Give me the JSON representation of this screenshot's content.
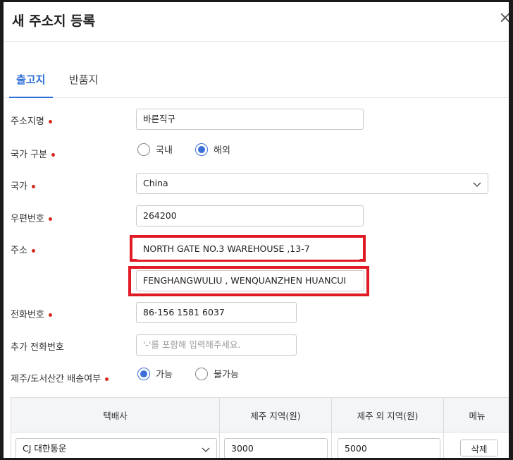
{
  "dialog": {
    "title": "새 주소지 등록",
    "close_glyph": "×"
  },
  "tabs": [
    {
      "label": "출고지",
      "active": true
    },
    {
      "label": "반품지",
      "active": false
    }
  ],
  "form": {
    "alias": {
      "label": "주소지명",
      "value": "바른직구"
    },
    "country_type": {
      "label": "국가 구분",
      "options": [
        {
          "label": "국내",
          "checked": false
        },
        {
          "label": "해외",
          "checked": true
        }
      ]
    },
    "country": {
      "label": "국가",
      "value": "China"
    },
    "zipcode": {
      "label": "우편번호",
      "value": "264200"
    },
    "address": {
      "label": "주소",
      "line1": "NORTH GATE NO.3 WAREHOUSE ,13-7",
      "line2": "FENGHANGWULIU , WENQUANZHEN HUANCUI"
    },
    "phone": {
      "label": "전화번호",
      "value": "86-156 1581 6037"
    },
    "extra_phone": {
      "label": "추가 전화번호",
      "placeholder": "'-'를 포함해 입력해주세요."
    },
    "jeju_delivery": {
      "label": "제주/도서산간 배송여부",
      "options": [
        {
          "label": "가능",
          "checked": true
        },
        {
          "label": "불가능",
          "checked": false
        }
      ]
    }
  },
  "shipping_table": {
    "headers": [
      "택배사",
      "제주 지역(원)",
      "제주 외 지역(원)",
      "메뉴"
    ],
    "rows": [
      {
        "carrier": "CJ 대한통운",
        "jeju_fee": "3000",
        "outside_fee": "5000",
        "action": "삭제"
      }
    ]
  },
  "colors": {
    "accent": "#2e6fd6",
    "required": "#d32a1e",
    "highlight": "#e01b25"
  }
}
